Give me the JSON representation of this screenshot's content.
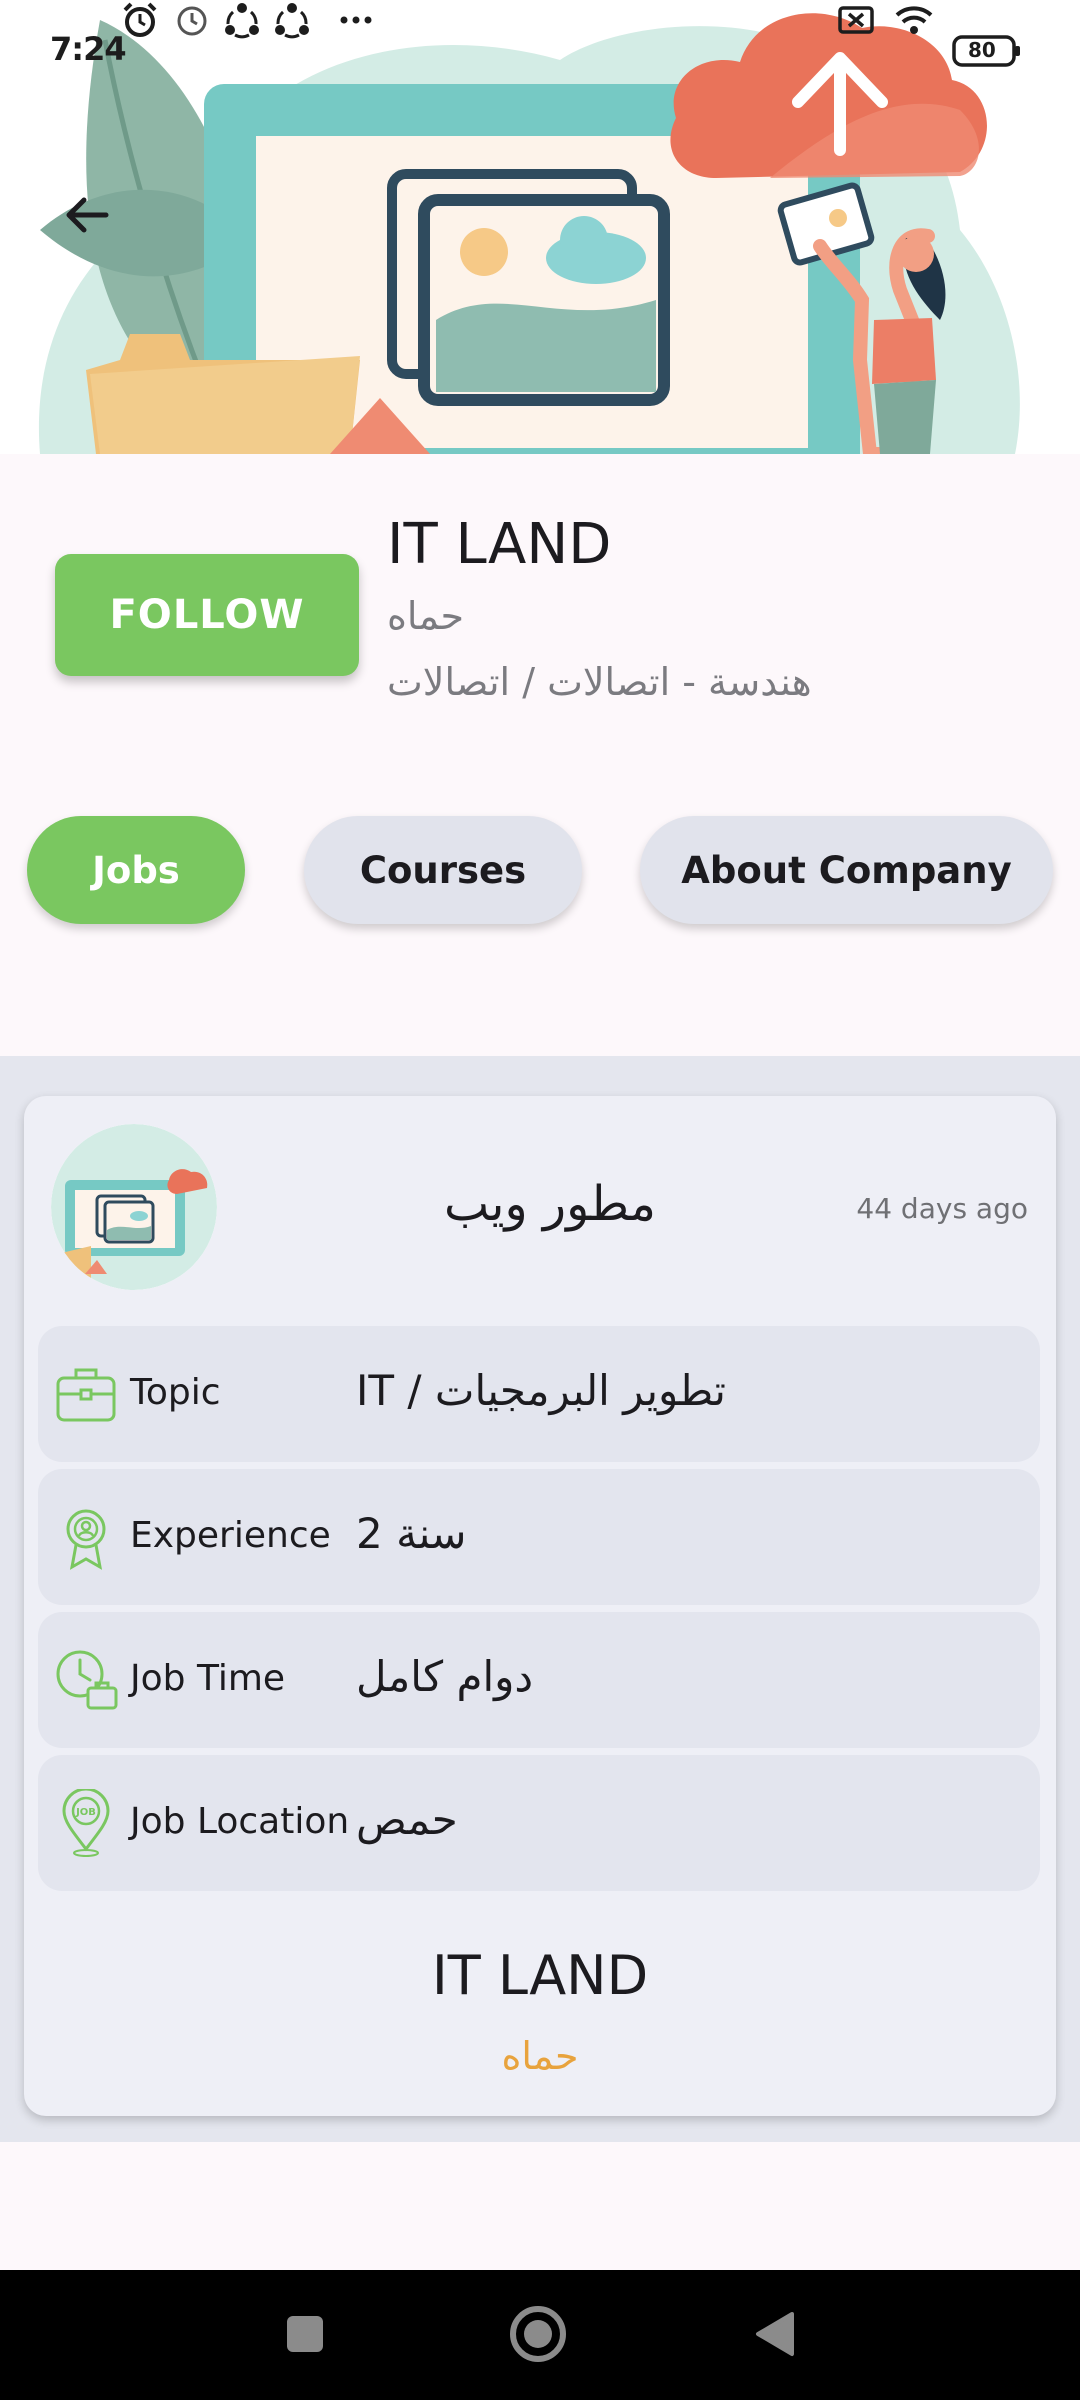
{
  "status_bar": {
    "time": "7:24",
    "battery": "80",
    "icons": [
      "alarm-icon",
      "alarm-icon",
      "sync-icon",
      "sync-icon",
      "more-icon",
      "sim-off-icon",
      "wifi-icon",
      "battery-icon"
    ]
  },
  "header": {
    "back_icon": "arrow-back-icon",
    "company_name": "IT LAND",
    "city": "حماه",
    "sector": "هندسة - اتصالات / اتصالات",
    "follow_label": "FOLLOW"
  },
  "tabs": [
    {
      "label": "Jobs",
      "selected": true
    },
    {
      "label": "Courses",
      "selected": false
    },
    {
      "label": "About Company",
      "selected": false
    }
  ],
  "job": {
    "title": "مطور ويب",
    "posted": "44 days ago",
    "rows": [
      {
        "icon": "briefcase-icon",
        "label": "Topic",
        "value": "IT / تطوير البرمجيات"
      },
      {
        "icon": "award-icon",
        "label": "Experience",
        "value": "2 سنة"
      },
      {
        "icon": "clock-icon",
        "label": "Job Time",
        "value": "دوام كامل"
      },
      {
        "icon": "location-pin-icon",
        "label": "Job Location",
        "value": "حمص"
      }
    ],
    "company": "IT LAND",
    "city": "حماه"
  },
  "nav": {
    "recents_icon": "square-icon",
    "home_icon": "circle-icon",
    "back_icon": "triangle-back-icon"
  },
  "colors": {
    "accent_green": "#7ac760",
    "chip_gray": "#e1e3ec",
    "card_bg": "#eeeff6",
    "city_orange": "#e8a33d"
  }
}
